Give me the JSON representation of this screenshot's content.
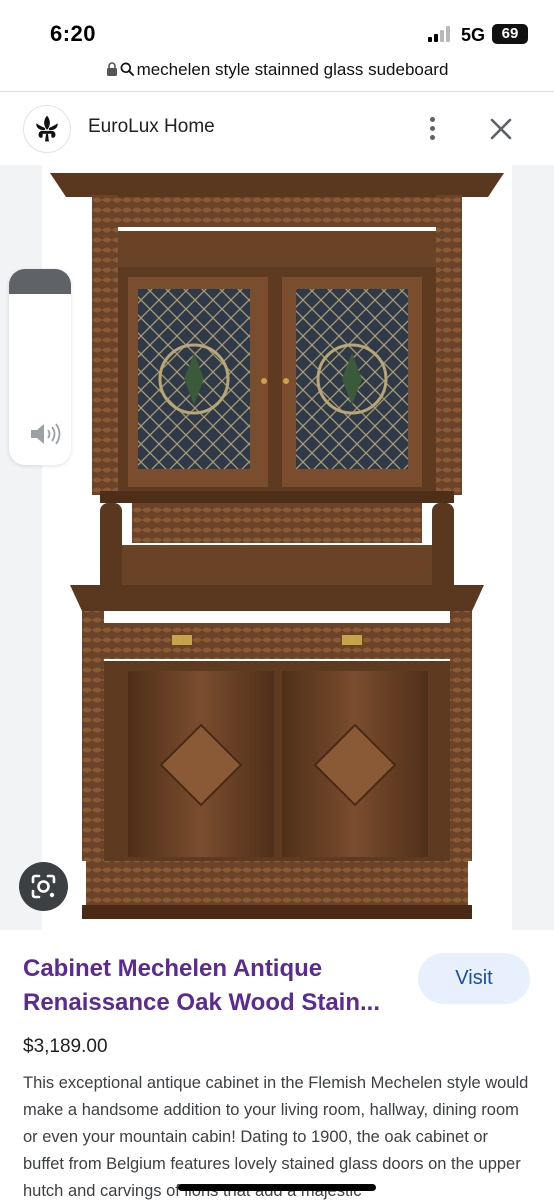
{
  "status_bar": {
    "time": "6:20",
    "network": "5G",
    "battery": "69"
  },
  "url_bar": {
    "lock_icon": "lock-icon",
    "search_icon": "search-icon",
    "query": "mechelen style stainned glass sudeboard"
  },
  "site_header": {
    "logo_icon": "fleur-de-lis-icon",
    "site_name": "EuroLux Home",
    "more_icon": "more-vertical-icon",
    "close_icon": "close-icon"
  },
  "image": {
    "alt_subject": "carved oak cabinet with stained glass doors",
    "volume_level": 0.13,
    "lens_icon": "lens-search-icon"
  },
  "result": {
    "title": "Cabinet Mechelen Antique Renaissance Oak Wood Stain...",
    "visit_label": "Visit",
    "price": "$3,189.00",
    "description": "This exceptional antique cabinet in the Flemish Mechelen style would make a handsome addition to your living room, hallway, dining room or even your mountain cabin! Dating to 1900, the oak cabinet or buffet from Belgium features lovely stained glass doors on the upper hutch and carvings of lions that add a majestic"
  },
  "colors": {
    "title": "#5b2a93",
    "visit_bg": "#e8f0fe",
    "visit_text": "#1a4fa3",
    "wood": "#6b4328"
  }
}
